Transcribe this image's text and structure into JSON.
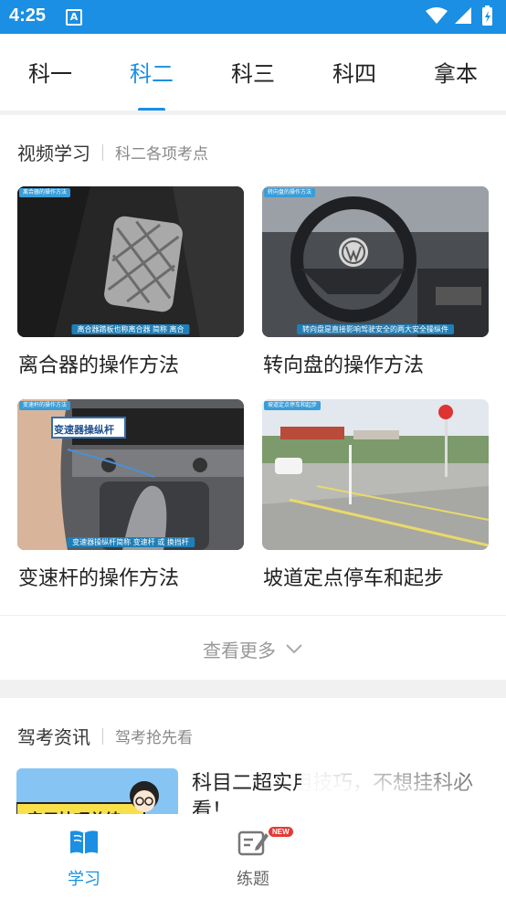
{
  "status_bar": {
    "time": "4:25",
    "notif_letter": "A"
  },
  "tabs": [
    {
      "label": "科一",
      "active": false
    },
    {
      "label": "科二",
      "active": true
    },
    {
      "label": "科三",
      "active": false
    },
    {
      "label": "科四",
      "active": false
    },
    {
      "label": "拿本",
      "active": false
    }
  ],
  "video_section": {
    "title": "视频学习",
    "subtitle": "科二各项考点",
    "items": [
      {
        "title": "离合器的操作方法",
        "thumb_tag": "离合器的操作方法",
        "thumb_caption": "离合器踏板也称离合器  简称 离合"
      },
      {
        "title": "转向盘的操作方法",
        "thumb_tag": "转向盘的操作方法",
        "thumb_caption": "转向盘是直接影响驾驶安全的两大安全操纵件"
      },
      {
        "title": "变速杆的操作方法",
        "thumb_tag": "变速杆的操作方法",
        "thumb_caption": "变速器操纵杆简称 变速杆 或 换挡杆",
        "thumb_label": "变速器操纵杆"
      },
      {
        "title": "坡道定点停车和起步",
        "thumb_tag": "坡道定点停车和起步"
      }
    ],
    "more_label": "查看更多"
  },
  "news_section": {
    "title": "驾考资讯",
    "subtitle": "驾考抢先看",
    "items": [
      {
        "title": "科目二超实用技巧，不想挂科必看！",
        "thumb_text": "实用技巧总结"
      }
    ]
  },
  "bottom_nav": [
    {
      "label": "学习",
      "active": true,
      "icon": "book-icon"
    },
    {
      "label": "练题",
      "active": false,
      "icon": "edit-icon",
      "badge": "NEW"
    }
  ],
  "colors": {
    "accent": "#1a8fe3",
    "inactive": "#666666",
    "badge": "#e53935"
  }
}
